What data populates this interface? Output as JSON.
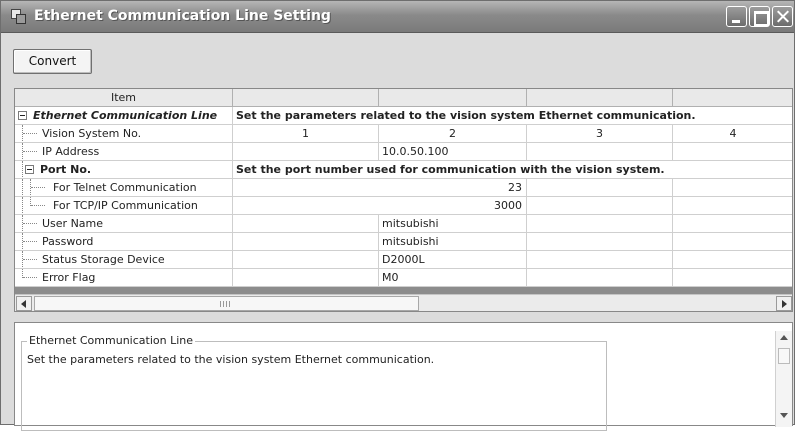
{
  "window": {
    "title": "Ethernet Communication Line Setting"
  },
  "toolbar": {
    "convert_label": "Convert"
  },
  "grid": {
    "header": [
      "Item",
      "",
      "",
      "",
      ""
    ],
    "section_title": "Ethernet Communication Line",
    "section_note": "Set the parameters related to the vision system Ethernet communication.",
    "rows": {
      "vision_no": {
        "label": "Vision System No.",
        "values": [
          "1",
          "2",
          "3",
          "4"
        ]
      },
      "ip": {
        "label": "IP Address",
        "values": [
          "",
          "10.0.50.100",
          "",
          ""
        ]
      },
      "port": {
        "label": "Port No.",
        "note": "Set the port number used for communication with the vision system."
      },
      "telnet": {
        "label": "For Telnet Communication",
        "value": "23"
      },
      "tcpip": {
        "label": "For TCP/IP Communication",
        "value": "3000"
      },
      "user": {
        "label": "User Name",
        "values": [
          "",
          "mitsubishi",
          "",
          ""
        ]
      },
      "password": {
        "label": "Password",
        "values": [
          "",
          "mitsubishi",
          "",
          ""
        ]
      },
      "status": {
        "label": "Status Storage Device",
        "values": [
          "",
          "D2000L",
          "",
          ""
        ]
      },
      "error": {
        "label": "Error Flag",
        "values": [
          "",
          "M0",
          "",
          ""
        ]
      }
    }
  },
  "description": {
    "title": "Ethernet Communication Line",
    "text": "Set the parameters related to the vision system Ethernet communication."
  },
  "icons": {
    "window": "window-app-icon",
    "minimize": "minimize-icon",
    "maximize": "maximize-icon",
    "close": "close-icon",
    "collapse": "collapse-minus-icon",
    "scroll_left": "arrow-left-icon",
    "scroll_right": "arrow-right-icon",
    "scroll_up": "arrow-up-icon",
    "scroll_down": "arrow-down-icon"
  }
}
